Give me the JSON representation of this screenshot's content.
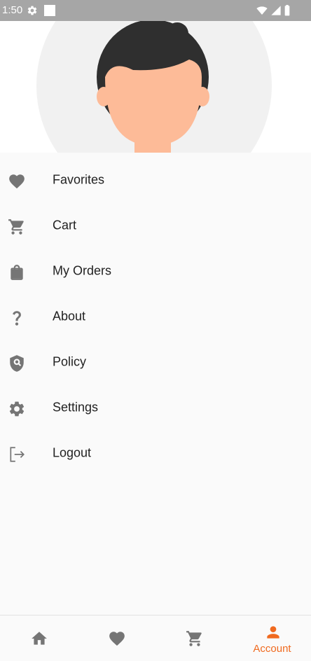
{
  "status_bar": {
    "time": "1:50"
  },
  "menu": {
    "items": [
      {
        "label": "Favorites",
        "icon": "heart-icon"
      },
      {
        "label": "Cart",
        "icon": "cart-icon"
      },
      {
        "label": "My Orders",
        "icon": "shopping-bag-icon"
      },
      {
        "label": "About",
        "icon": "question-icon"
      },
      {
        "label": "Policy",
        "icon": "shield-icon"
      },
      {
        "label": "Settings",
        "icon": "gear-icon"
      },
      {
        "label": "Logout",
        "icon": "logout-icon"
      }
    ]
  },
  "bottom_nav": {
    "items": [
      {
        "icon": "home-icon"
      },
      {
        "icon": "heart-icon"
      },
      {
        "icon": "cart-icon"
      },
      {
        "icon": "person-icon",
        "label": "Account",
        "active": true
      }
    ]
  },
  "colors": {
    "accent": "#f06a1f",
    "icon_gray": "#757575",
    "avatar_skin": "#fdbb98",
    "avatar_hair": "#2f2f2f"
  }
}
